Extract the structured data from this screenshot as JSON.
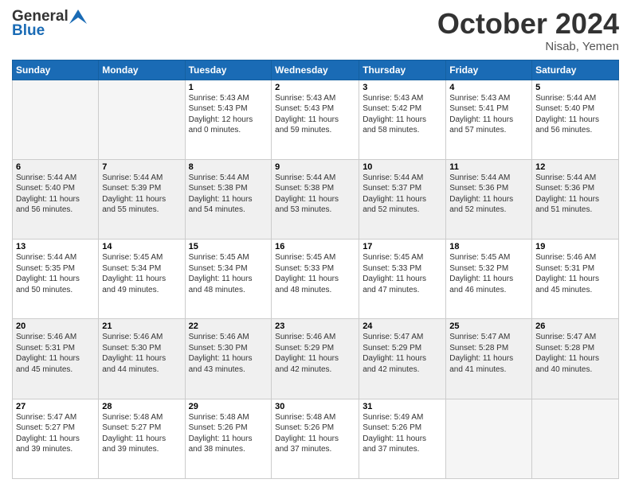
{
  "header": {
    "logo_general": "General",
    "logo_blue": "Blue",
    "month_title": "October 2024",
    "location": "Nisab, Yemen"
  },
  "days_of_week": [
    "Sunday",
    "Monday",
    "Tuesday",
    "Wednesday",
    "Thursday",
    "Friday",
    "Saturday"
  ],
  "weeks": [
    [
      {
        "day": "",
        "info": ""
      },
      {
        "day": "",
        "info": ""
      },
      {
        "day": "1",
        "info": "Sunrise: 5:43 AM\nSunset: 5:43 PM\nDaylight: 12 hours\nand 0 minutes."
      },
      {
        "day": "2",
        "info": "Sunrise: 5:43 AM\nSunset: 5:43 PM\nDaylight: 11 hours\nand 59 minutes."
      },
      {
        "day": "3",
        "info": "Sunrise: 5:43 AM\nSunset: 5:42 PM\nDaylight: 11 hours\nand 58 minutes."
      },
      {
        "day": "4",
        "info": "Sunrise: 5:43 AM\nSunset: 5:41 PM\nDaylight: 11 hours\nand 57 minutes."
      },
      {
        "day": "5",
        "info": "Sunrise: 5:44 AM\nSunset: 5:40 PM\nDaylight: 11 hours\nand 56 minutes."
      }
    ],
    [
      {
        "day": "6",
        "info": "Sunrise: 5:44 AM\nSunset: 5:40 PM\nDaylight: 11 hours\nand 56 minutes."
      },
      {
        "day": "7",
        "info": "Sunrise: 5:44 AM\nSunset: 5:39 PM\nDaylight: 11 hours\nand 55 minutes."
      },
      {
        "day": "8",
        "info": "Sunrise: 5:44 AM\nSunset: 5:38 PM\nDaylight: 11 hours\nand 54 minutes."
      },
      {
        "day": "9",
        "info": "Sunrise: 5:44 AM\nSunset: 5:38 PM\nDaylight: 11 hours\nand 53 minutes."
      },
      {
        "day": "10",
        "info": "Sunrise: 5:44 AM\nSunset: 5:37 PM\nDaylight: 11 hours\nand 52 minutes."
      },
      {
        "day": "11",
        "info": "Sunrise: 5:44 AM\nSunset: 5:36 PM\nDaylight: 11 hours\nand 52 minutes."
      },
      {
        "day": "12",
        "info": "Sunrise: 5:44 AM\nSunset: 5:36 PM\nDaylight: 11 hours\nand 51 minutes."
      }
    ],
    [
      {
        "day": "13",
        "info": "Sunrise: 5:44 AM\nSunset: 5:35 PM\nDaylight: 11 hours\nand 50 minutes."
      },
      {
        "day": "14",
        "info": "Sunrise: 5:45 AM\nSunset: 5:34 PM\nDaylight: 11 hours\nand 49 minutes."
      },
      {
        "day": "15",
        "info": "Sunrise: 5:45 AM\nSunset: 5:34 PM\nDaylight: 11 hours\nand 48 minutes."
      },
      {
        "day": "16",
        "info": "Sunrise: 5:45 AM\nSunset: 5:33 PM\nDaylight: 11 hours\nand 48 minutes."
      },
      {
        "day": "17",
        "info": "Sunrise: 5:45 AM\nSunset: 5:33 PM\nDaylight: 11 hours\nand 47 minutes."
      },
      {
        "day": "18",
        "info": "Sunrise: 5:45 AM\nSunset: 5:32 PM\nDaylight: 11 hours\nand 46 minutes."
      },
      {
        "day": "19",
        "info": "Sunrise: 5:46 AM\nSunset: 5:31 PM\nDaylight: 11 hours\nand 45 minutes."
      }
    ],
    [
      {
        "day": "20",
        "info": "Sunrise: 5:46 AM\nSunset: 5:31 PM\nDaylight: 11 hours\nand 45 minutes."
      },
      {
        "day": "21",
        "info": "Sunrise: 5:46 AM\nSunset: 5:30 PM\nDaylight: 11 hours\nand 44 minutes."
      },
      {
        "day": "22",
        "info": "Sunrise: 5:46 AM\nSunset: 5:30 PM\nDaylight: 11 hours\nand 43 minutes."
      },
      {
        "day": "23",
        "info": "Sunrise: 5:46 AM\nSunset: 5:29 PM\nDaylight: 11 hours\nand 42 minutes."
      },
      {
        "day": "24",
        "info": "Sunrise: 5:47 AM\nSunset: 5:29 PM\nDaylight: 11 hours\nand 42 minutes."
      },
      {
        "day": "25",
        "info": "Sunrise: 5:47 AM\nSunset: 5:28 PM\nDaylight: 11 hours\nand 41 minutes."
      },
      {
        "day": "26",
        "info": "Sunrise: 5:47 AM\nSunset: 5:28 PM\nDaylight: 11 hours\nand 40 minutes."
      }
    ],
    [
      {
        "day": "27",
        "info": "Sunrise: 5:47 AM\nSunset: 5:27 PM\nDaylight: 11 hours\nand 39 minutes."
      },
      {
        "day": "28",
        "info": "Sunrise: 5:48 AM\nSunset: 5:27 PM\nDaylight: 11 hours\nand 39 minutes."
      },
      {
        "day": "29",
        "info": "Sunrise: 5:48 AM\nSunset: 5:26 PM\nDaylight: 11 hours\nand 38 minutes."
      },
      {
        "day": "30",
        "info": "Sunrise: 5:48 AM\nSunset: 5:26 PM\nDaylight: 11 hours\nand 37 minutes."
      },
      {
        "day": "31",
        "info": "Sunrise: 5:49 AM\nSunset: 5:26 PM\nDaylight: 11 hours\nand 37 minutes."
      },
      {
        "day": "",
        "info": ""
      },
      {
        "day": "",
        "info": ""
      }
    ]
  ]
}
